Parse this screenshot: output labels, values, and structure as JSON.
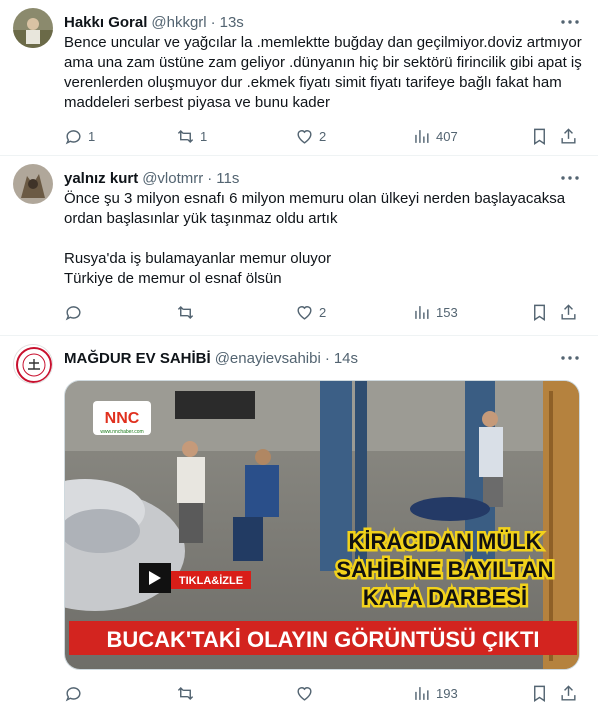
{
  "tweets": [
    {
      "author": {
        "name": "Hakkı Goral",
        "handle": "@hkkgrl",
        "time": "13s"
      },
      "text": "Bence uncular ve yağcılar la .memlektte buğday dan geçilmiyor.doviz artmıyor ama una zam üstüne zam geliyor .dünyanın hiç bir sektörü firincilik gibi apat iş verenlerden oluşmuyor dur .ekmek fiyatı simit fiyatı tarifeye bağlı fakat ham maddeleri serbest piyasa ve bunu kader",
      "stats": {
        "replies": "1",
        "retweets": "1",
        "likes": "2",
        "views": "407"
      }
    },
    {
      "author": {
        "name": "yalnız kurt",
        "handle": "@vlotmrr",
        "time": "11s"
      },
      "text": "Önce şu 3 milyon esnafı 6 milyon memuru olan ülkeyi nerden başlayacaksa ordan başlasınlar yük taşınmaz oldu artık\n\nRusya'da iş bulamayanlar memur oluyor\nTürkiye de memur ol esnaf ölsün",
      "stats": {
        "replies": "",
        "retweets": "",
        "likes": "2",
        "views": "153"
      }
    },
    {
      "author": {
        "name": "MAĞDUR EV SAHİBİ",
        "handle": "@enayievsahibi",
        "time": "14s"
      },
      "text": "",
      "media": {
        "logo": "NNC",
        "logo_sub": "www.nnchaber.com",
        "play_label": "TIKLA&İZLE",
        "headline_lines": [
          "KİRACIDAN MÜLK",
          "SAHİBİNE BAYILTAN",
          "KAFA DARBESİ"
        ],
        "caption": "BUCAK'TAKİ OLAYIN GÖRÜNTÜSÜ ÇIKTI"
      },
      "stats": {
        "replies": "",
        "retweets": "",
        "likes": "",
        "views": "193"
      }
    }
  ],
  "icons": [
    "more-icon",
    "reply-icon",
    "retweet-icon",
    "like-icon",
    "views-icon",
    "bookmark-icon",
    "share-icon"
  ]
}
